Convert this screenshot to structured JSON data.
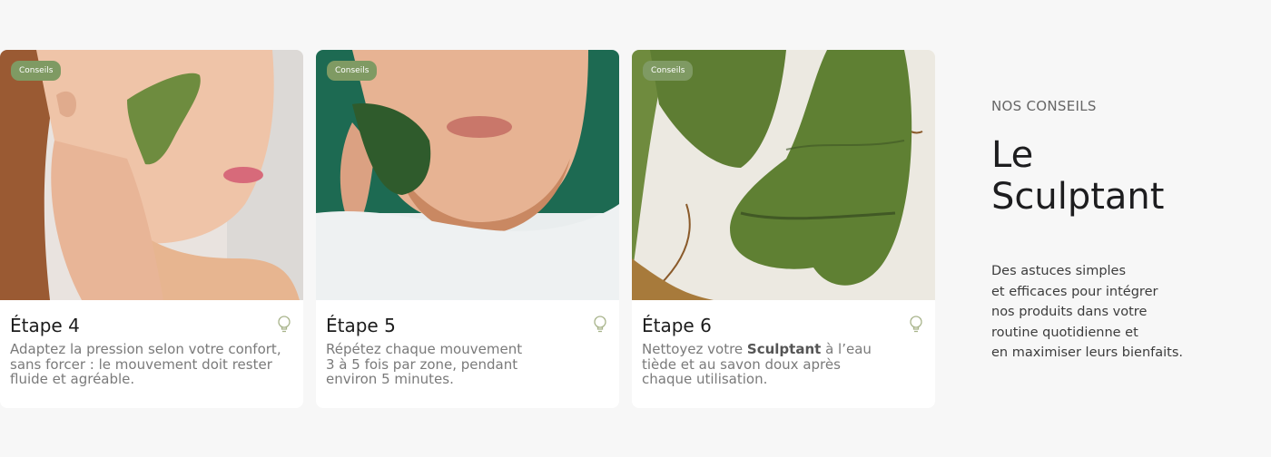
{
  "cards": [
    {
      "badge": "Conseils",
      "title": "Étape 4",
      "text_lines": [
        "Adaptez la pression selon votre confort,",
        "sans forcer : le mouvement doit rester",
        "fluide et agréable."
      ]
    },
    {
      "badge": "Conseils",
      "title": "Étape 5",
      "text_lines": [
        "Répétez chaque mouvement",
        "3 à 5 fois par zone, pendant",
        "environ 5 minutes."
      ]
    },
    {
      "badge": "Conseils",
      "title": "Étape 6",
      "text_parts": {
        "before": "Nettoyez votre ",
        "bold": "Sculptant",
        "after_line1": " à l’eau",
        "line2": "tiède et au savon doux après",
        "line3": "chaque utilisation."
      }
    }
  ],
  "side": {
    "eyebrow": "NOS CONSEILS",
    "heading_line1": "Le",
    "heading_line2": "Sculptant",
    "desc_lines": [
      "Des astuces simples",
      "et efficaces pour intégrer",
      "nos produits dans votre",
      "routine quotidienne et",
      "en maximiser leurs bienfaits."
    ]
  },
  "colors": {
    "badge": "#7f9a63",
    "jade": "#5d7b33",
    "background": "#f7f7f7"
  },
  "icons": [
    "lightbulb-icon"
  ]
}
